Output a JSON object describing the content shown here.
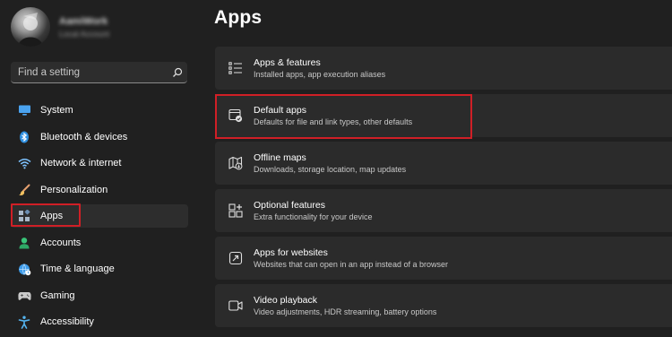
{
  "profile": {
    "name": "AamiWork",
    "account_type": "Local Account"
  },
  "search": {
    "placeholder": "Find a setting"
  },
  "sidebar": {
    "items": [
      {
        "label": "System",
        "icon": "monitor-icon"
      },
      {
        "label": "Bluetooth & devices",
        "icon": "bluetooth-icon"
      },
      {
        "label": "Network & internet",
        "icon": "wifi-icon"
      },
      {
        "label": "Personalization",
        "icon": "brush-icon"
      },
      {
        "label": "Apps",
        "icon": "apps-icon",
        "selected": true
      },
      {
        "label": "Accounts",
        "icon": "person-icon"
      },
      {
        "label": "Time & language",
        "icon": "globe-clock-icon"
      },
      {
        "label": "Gaming",
        "icon": "gamepad-icon"
      },
      {
        "label": "Accessibility",
        "icon": "accessibility-icon"
      }
    ]
  },
  "main": {
    "title": "Apps",
    "cards": [
      {
        "title": "Apps & features",
        "desc": "Installed apps, app execution aliases",
        "icon": "list-icon"
      },
      {
        "title": "Default apps",
        "desc": "Defaults for file and link types, other defaults",
        "icon": "default-apps-icon",
        "highlighted": true
      },
      {
        "title": "Offline maps",
        "desc": "Downloads, storage location, map updates",
        "icon": "map-icon"
      },
      {
        "title": "Optional features",
        "desc": "Extra functionality for your device",
        "icon": "add-grid-icon"
      },
      {
        "title": "Apps for websites",
        "desc": "Websites that can open in an app instead of a browser",
        "icon": "open-link-icon"
      },
      {
        "title": "Video playback",
        "desc": "Video adjustments, HDR streaming, battery options",
        "icon": "video-icon"
      }
    ]
  },
  "colors": {
    "background": "#202020",
    "card": "#2b2b2b",
    "highlight": "#d01f26",
    "accent": "#4cc2ff"
  }
}
